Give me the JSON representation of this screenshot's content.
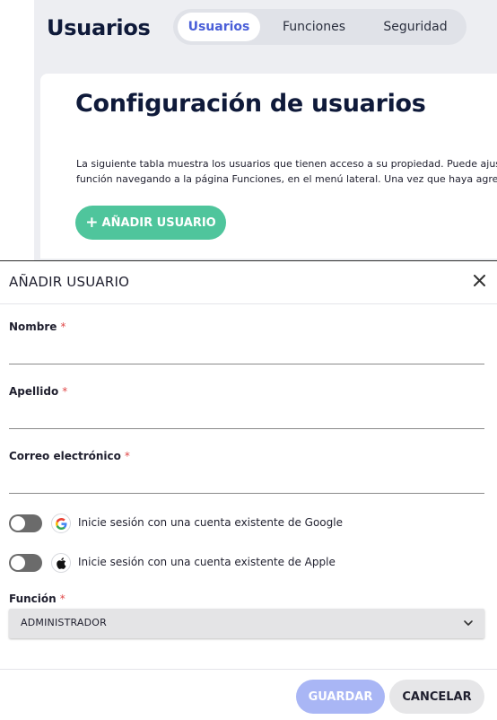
{
  "header": {
    "title": "Usuarios",
    "tabs": [
      {
        "label": "Usuarios",
        "active": true
      },
      {
        "label": "Funciones",
        "active": false
      },
      {
        "label": "Seguridad",
        "active": false
      }
    ]
  },
  "card": {
    "heading": "Configuración de usuarios",
    "text_line1": "La siguiente tabla muestra los usuarios que tienen acceso a su propiedad. Puede ajustar los permisos de cada",
    "text_line2": "función navegando a la página Funciones, en el menú lateral. Una vez que haya agregado un usuario",
    "add_button_label": "AÑADIR USUARIO",
    "add_button_icon": "plus-icon"
  },
  "modal": {
    "title": "AÑADIR USUARIO",
    "close_icon": "close-icon",
    "required_mark": "*",
    "fields": {
      "nombre": {
        "label": "Nombre",
        "value": "",
        "placeholder": ""
      },
      "apellido": {
        "label": "Apellido",
        "value": "",
        "placeholder": ""
      },
      "correo": {
        "label": "Correo electrónico",
        "value": "",
        "placeholder": ""
      }
    },
    "google": {
      "text": "Inicie sesión con una cuenta existente de Google",
      "enabled": false,
      "icon": "google-icon"
    },
    "apple": {
      "text": "Inicie sesión con una cuenta existente de Apple",
      "enabled": false,
      "icon": "apple-icon"
    },
    "funcion": {
      "label": "Función",
      "selected": "ADMINISTRADOR",
      "icon": "chevron-down-icon"
    },
    "save_label": "GUARDAR",
    "cancel_label": "CANCELAR"
  },
  "colors": {
    "accent_green": "#4fc59c",
    "accent_blue": "#4a5fd8",
    "save_disabled": "#a9b6f5",
    "required": "#e04848"
  }
}
